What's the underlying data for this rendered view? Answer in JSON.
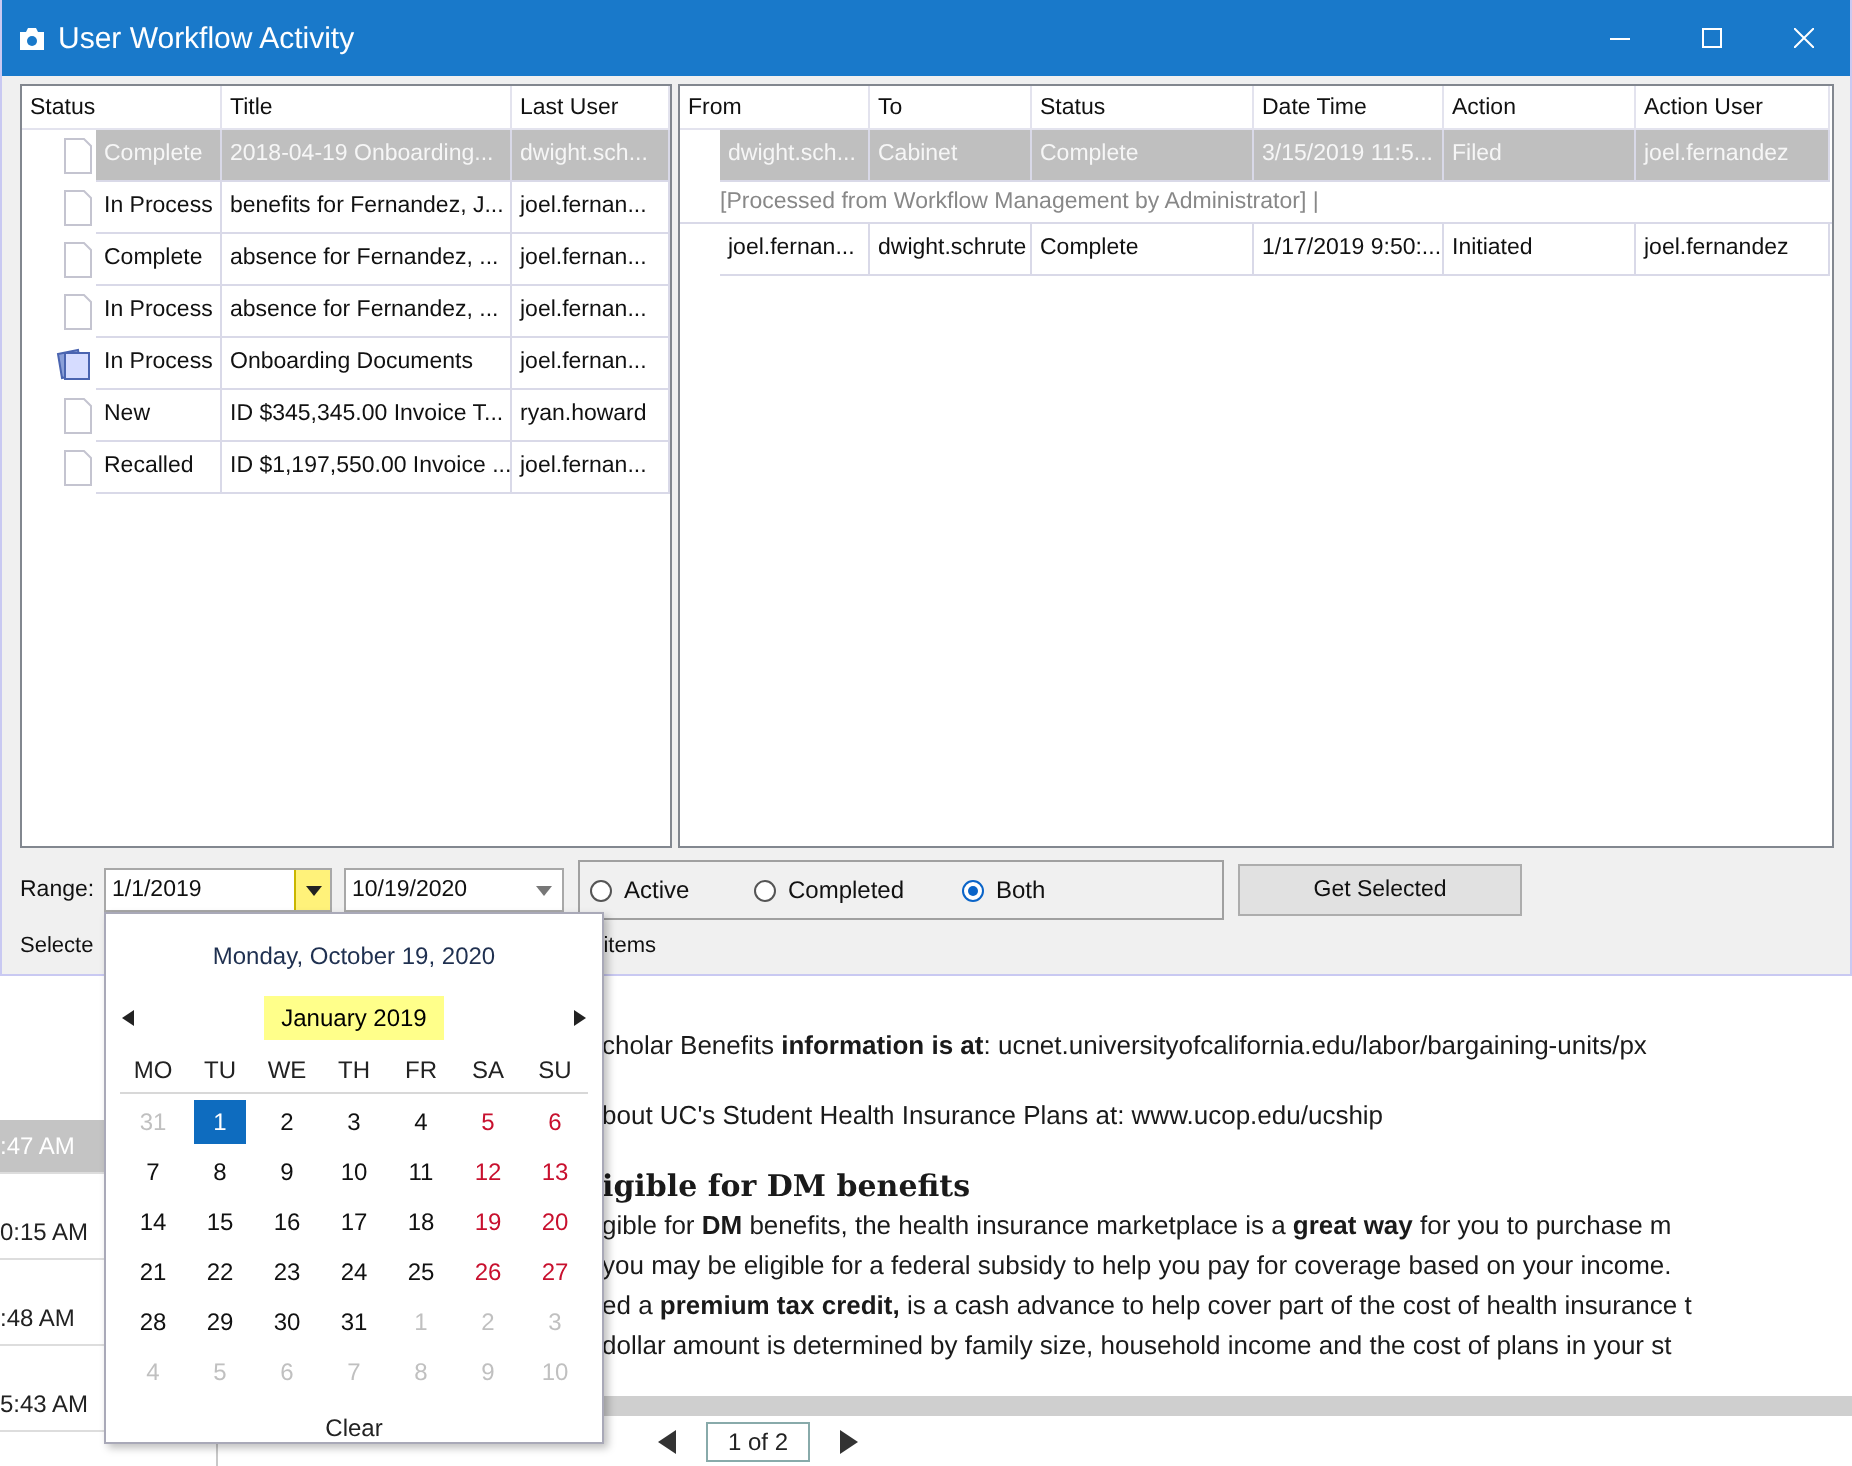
{
  "window": {
    "title": "User Workflow Activity"
  },
  "documents": {
    "columns": [
      "Status",
      "Title",
      "Last User"
    ],
    "rows": [
      {
        "kind": "document",
        "status": "Complete",
        "title": "2018-04-19 Onboarding...",
        "last_user": "dwight.sch...",
        "selected": true
      },
      {
        "kind": "document",
        "status": "In Process",
        "title": "benefits for Fernandez, J...",
        "last_user": "joel.fernan...",
        "selected": false
      },
      {
        "kind": "document",
        "status": "Complete",
        "title": "absence for Fernandez, ...",
        "last_user": "joel.fernan...",
        "selected": false
      },
      {
        "kind": "document",
        "status": "In Process",
        "title": "absence for Fernandez, ...",
        "last_user": "joel.fernan...",
        "selected": false
      },
      {
        "kind": "stack",
        "status": "In Process",
        "title": "Onboarding Documents",
        "last_user": "joel.fernan...",
        "selected": false
      },
      {
        "kind": "document",
        "status": "New",
        "title": "ID $345,345.00 Invoice T...",
        "last_user": "ryan.howard",
        "selected": false
      },
      {
        "kind": "document",
        "status": "Recalled",
        "title": "ID $1,197,550.00 Invoice ...",
        "last_user": "joel.fernan...",
        "selected": false
      }
    ]
  },
  "history": {
    "columns": [
      "From",
      "To",
      "Status",
      "Date Time",
      "Action",
      "Action User"
    ],
    "rows": [
      {
        "kind": "entry",
        "cells": [
          "dwight.sch...",
          "Cabinet",
          "Complete",
          "3/15/2019 11:5...",
          "Filed",
          "joel.fernandez"
        ],
        "selected": true
      },
      {
        "kind": "note",
        "text": "[Processed from Workflow Management by Administrator]  |",
        "selected": false
      },
      {
        "kind": "entry",
        "cells": [
          "joel.fernan...",
          "dwight.schrute",
          "Complete",
          "1/17/2019 9:50:...",
          "Initiated",
          "joel.fernandez"
        ],
        "selected": false
      }
    ]
  },
  "range": {
    "label": "Range:",
    "from": {
      "value": "1/1/2019",
      "open": true
    },
    "to": {
      "value": "10/19/2020",
      "open": false
    }
  },
  "filter": {
    "options": [
      {
        "label": "Active",
        "selected": false
      },
      {
        "label": "Completed",
        "selected": false
      },
      {
        "label": "Both",
        "selected": true
      }
    ]
  },
  "get_button": "Get Selected",
  "footer": {
    "label": "Selecte",
    "suffix": "items"
  },
  "calendar": {
    "today": "Monday, October 19, 2020",
    "month": "January 2019",
    "day_headers": [
      {
        "text": "MO",
        "weekend": false
      },
      {
        "text": "TU",
        "weekend": false
      },
      {
        "text": "WE",
        "weekend": false
      },
      {
        "text": "TH",
        "weekend": false
      },
      {
        "text": "FR",
        "weekend": false
      },
      {
        "text": "SA",
        "weekend": true
      },
      {
        "text": "SU",
        "weekend": true
      }
    ],
    "days": [
      {
        "day": "31",
        "other_month": true,
        "selected": false
      },
      {
        "day": "1",
        "other_month": false,
        "selected": true
      },
      {
        "day": "2",
        "other_month": false,
        "selected": false
      },
      {
        "day": "3",
        "other_month": false,
        "selected": false
      },
      {
        "day": "4",
        "other_month": false,
        "selected": false
      },
      {
        "day": "5",
        "other_month": false,
        "selected": false
      },
      {
        "day": "6",
        "other_month": false,
        "selected": false
      },
      {
        "day": "7",
        "other_month": false,
        "selected": false
      },
      {
        "day": "8",
        "other_month": false,
        "selected": false
      },
      {
        "day": "9",
        "other_month": false,
        "selected": false
      },
      {
        "day": "10",
        "other_month": false,
        "selected": false
      },
      {
        "day": "11",
        "other_month": false,
        "selected": false
      },
      {
        "day": "12",
        "other_month": false,
        "selected": false
      },
      {
        "day": "13",
        "other_month": false,
        "selected": false
      },
      {
        "day": "14",
        "other_month": false,
        "selected": false
      },
      {
        "day": "15",
        "other_month": false,
        "selected": false
      },
      {
        "day": "16",
        "other_month": false,
        "selected": false
      },
      {
        "day": "17",
        "other_month": false,
        "selected": false
      },
      {
        "day": "18",
        "other_month": false,
        "selected": false
      },
      {
        "day": "19",
        "other_month": false,
        "selected": false
      },
      {
        "day": "20",
        "other_month": false,
        "selected": false
      },
      {
        "day": "21",
        "other_month": false,
        "selected": false
      },
      {
        "day": "22",
        "other_month": false,
        "selected": false
      },
      {
        "day": "23",
        "other_month": false,
        "selected": false
      },
      {
        "day": "24",
        "other_month": false,
        "selected": false
      },
      {
        "day": "25",
        "other_month": false,
        "selected": false
      },
      {
        "day": "26",
        "other_month": false,
        "selected": false
      },
      {
        "day": "27",
        "other_month": false,
        "selected": false
      },
      {
        "day": "28",
        "other_month": false,
        "selected": false
      },
      {
        "day": "29",
        "other_month": false,
        "selected": false
      },
      {
        "day": "30",
        "other_month": false,
        "selected": false
      },
      {
        "day": "31",
        "other_month": false,
        "selected": false
      },
      {
        "day": "1",
        "other_month": true,
        "selected": false
      },
      {
        "day": "2",
        "other_month": true,
        "selected": false
      },
      {
        "day": "3",
        "other_month": true,
        "selected": false
      },
      {
        "day": "4",
        "other_month": true,
        "selected": false
      },
      {
        "day": "5",
        "other_month": true,
        "selected": false
      },
      {
        "day": "6",
        "other_month": true,
        "selected": false
      },
      {
        "day": "7",
        "other_month": true,
        "selected": false
      },
      {
        "day": "8",
        "other_month": true,
        "selected": false
      },
      {
        "day": "9",
        "other_month": true,
        "selected": false
      },
      {
        "day": "10",
        "other_month": true,
        "selected": false
      }
    ],
    "clear": "Clear"
  },
  "background": {
    "times": [
      {
        "text": ":47 AM",
        "selected": true
      },
      {
        "text": "0:15 AM",
        "selected": false
      },
      {
        "text": ":48 AM",
        "selected": false
      },
      {
        "text": "5:43 AM",
        "selected": false
      }
    ],
    "document_lines": [
      {
        "kind": "paragraph",
        "text": "cholar Benefits **information is at**: ucnet.universityofcalifornia.edu/labor/bargaining-units/px"
      },
      {
        "kind": "paragraph",
        "text": "bout UC's Student Health Insurance Plans at: www.ucop.edu/ucship"
      },
      {
        "kind": "heading",
        "text": "igible for DM benefits"
      },
      {
        "kind": "line",
        "text": "gible for **DM** benefits, the health insurance marketplace is a **great way** for you to purchase m"
      },
      {
        "kind": "line",
        "text": "you may be eligible for a federal subsidy to help you pay for coverage based on your income."
      },
      {
        "kind": "line",
        "text": "ed a **premium tax credit,** is a cash advance to help cover part of the cost of health insurance t"
      },
      {
        "kind": "line",
        "text": "dollar amount is determined by family size, household income and the cost of plans in your st"
      }
    ],
    "pager": "1 of 2"
  }
}
